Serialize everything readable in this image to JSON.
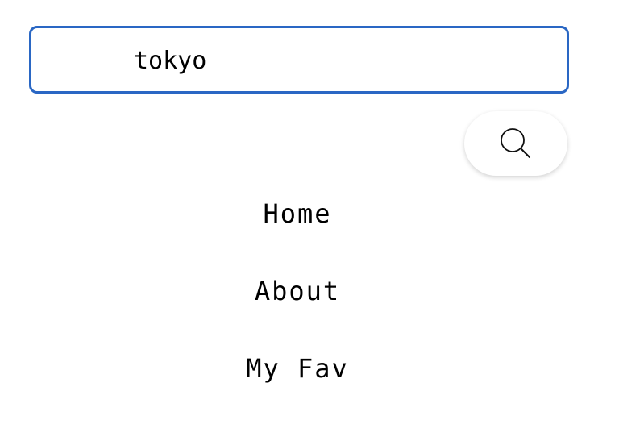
{
  "search": {
    "value": "tokyo",
    "button_icon": "search-icon"
  },
  "nav": {
    "items": [
      {
        "label": "Home"
      },
      {
        "label": "About"
      },
      {
        "label": "My Fav"
      }
    ]
  }
}
